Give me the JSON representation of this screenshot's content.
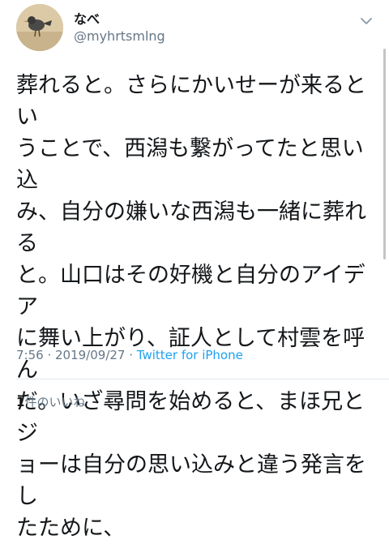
{
  "author": {
    "display_name": "なべ",
    "handle": "@myhrtsmlng",
    "avatar_icon": "bird-avatar-icon"
  },
  "menu": {
    "icon": "chevron-down-icon"
  },
  "tweet": {
    "text": "葬れると。さらにかいせーが来るとい\nうことで、西潟も繋がってたと思い込\nみ、自分の嫌いな西潟も一緒に葬れる\nと。山口はその好機と自分のアイデア\nに舞い上がり、証人として村雲を呼ん\nだ。いざ尋問を始めると、まほ兄とジ\nョーは自分の思い込みと違う発言をし\nたために、"
  },
  "meta": {
    "time": "7:56",
    "separator1": " · ",
    "date": "2019/09/27",
    "separator2": " · ",
    "source": "Twitter for iPhone"
  },
  "likes": {
    "count": "1",
    "label": "件のいいね"
  },
  "colors": {
    "text": "#14171a",
    "secondary": "#657786",
    "link": "#1da1f2",
    "divider": "#e1e8ed"
  }
}
